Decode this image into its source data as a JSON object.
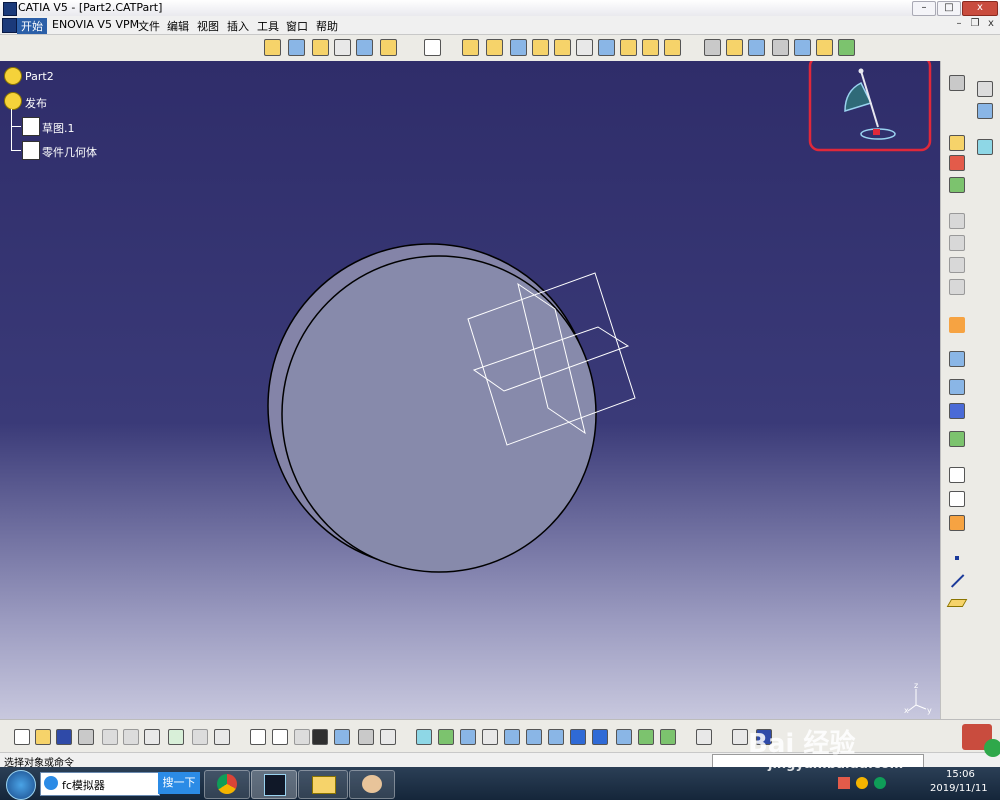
{
  "window": {
    "title": "CATIA V5 - [Part2.CATPart]",
    "minimize": "–",
    "maximize": "□",
    "close": "x"
  },
  "menu": {
    "items": [
      "开始",
      "ENOVIA V5 VPM",
      "文件",
      "编辑",
      "视图",
      "插入",
      "工具",
      "窗口",
      "帮助"
    ],
    "mdi_min": "–",
    "mdi_restore": "❐",
    "mdi_close": "x"
  },
  "tree": {
    "root": "Part2",
    "publish": "发布",
    "sketch": "草图.1",
    "body": "零件几何体"
  },
  "compass": {
    "axis_z": "z",
    "axis_x": "x",
    "axis_y": "y"
  },
  "status": {
    "text": "选择对象或命令"
  },
  "taskbar": {
    "search_text": "fc模拟器",
    "search_button": "搜一下",
    "time": "15:06",
    "date": "2019/11/11",
    "watermark_main": "Bai  经验",
    "watermark_url": "jingyan.baidu.com"
  },
  "colors": {
    "viewport_top": "#2f2d6a",
    "highlight_box": "#e0283a",
    "accent": "#2b5fa8"
  }
}
